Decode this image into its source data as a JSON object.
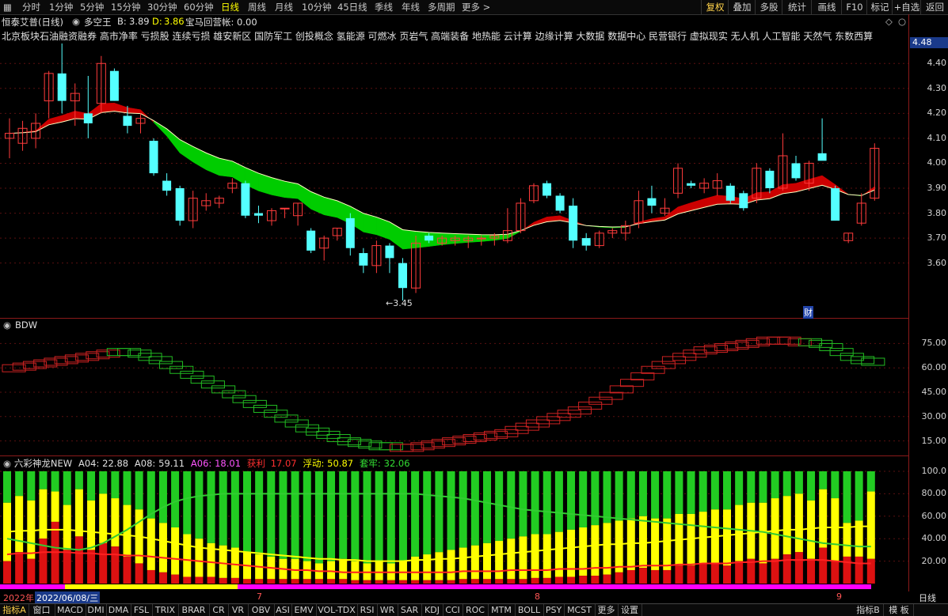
{
  "periods": [
    "分时",
    "1分钟",
    "5分钟",
    "15分钟",
    "30分钟",
    "60分钟",
    "日线",
    "周线",
    "月线",
    "10分钟",
    "45日线",
    "季线",
    "年线",
    "多周期",
    "更多 >"
  ],
  "active_period": "日线",
  "right_tools": [
    "复权",
    "叠加",
    "多股",
    "统计",
    "画线",
    "F10",
    "标记",
    "+自选",
    "返回"
  ],
  "title": {
    "stock": "恒泰艾普(日线)",
    "indicator": "多空王",
    "b_label": "B:",
    "b_value": "3.89",
    "d_label": "D:",
    "d_value": "3.86",
    "extra": "宝马回营帐: 0.00"
  },
  "sectors": "北京板块石油融资融券 高市净率 亏损股 连续亏损 雄安新区 国防军工 创投概念 氢能源 可燃冰 页岩气 高端装备 地热能 云计算 边缘计算 大数据 数据中心 民营银行 虚拟现实 无人机 人工智能 天然气 东数西算",
  "price_axis": {
    "current": "4.48",
    "ticks": [
      "4.40",
      "4.30",
      "4.20",
      "4.10",
      "4.00",
      "3.90",
      "3.80",
      "3.70",
      "3.60"
    ],
    "low_label": "3.45",
    "cai_label": "财"
  },
  "bdw": {
    "title": "BDW",
    "ticks": [
      "75.00",
      "60.00",
      "45.00",
      "30.00",
      "15.00"
    ]
  },
  "liucai": {
    "name": "六彩神龙NEW",
    "a04_label": "A04:",
    "a04": "22.88",
    "a08_label": "A08:",
    "a08": "59.11",
    "a06_label": "A06:",
    "a06": "18.01",
    "profit_label": "获利",
    "profit": "17.07",
    "float_label": "浮动:",
    "float": "50.87",
    "trap_label": "套牢:",
    "trap": "32.06",
    "ticks": [
      "100.0",
      "80.00",
      "60.00",
      "40.00",
      "20.00"
    ]
  },
  "date_axis": {
    "year": "2022年",
    "cursor_date": "2022/06/08/三",
    "months": [
      "7",
      "8",
      "9"
    ],
    "right_label": "日线"
  },
  "bottom_tabs": [
    "指标A",
    "窗口",
    "MACD",
    "DMI",
    "DMA",
    "FSL",
    "TRIX",
    "BRAR",
    "CR",
    "VR",
    "OBV",
    "ASI",
    "EMV",
    "VOL-TDX",
    "RSI",
    "WR",
    "SAR",
    "KDJ",
    "CCI",
    "ROC",
    "MTM",
    "BOLL",
    "PSY",
    "MCST",
    "更多",
    "设置"
  ],
  "bottom_right": [
    "指标B",
    "模 板"
  ],
  "colors": {
    "up": "#ff3b3b",
    "down": "#54ffff",
    "ma_red": "#cc0000",
    "ma_green": "#00cc00",
    "yellow": "#ffff00",
    "magenta": "#ff00ff"
  },
  "chart_data": [
    {
      "type": "candlestick",
      "title": "恒泰艾普(日线)",
      "ylim": [
        3.45,
        4.48
      ],
      "candles": [
        {
          "o": 4.1,
          "h": 4.18,
          "l": 4.02,
          "c": 4.12
        },
        {
          "o": 4.08,
          "h": 4.17,
          "l": 4.05,
          "c": 4.14
        },
        {
          "o": 4.1,
          "h": 4.2,
          "l": 4.06,
          "c": 4.16
        },
        {
          "o": 4.25,
          "h": 4.37,
          "l": 4.18,
          "c": 4.36
        },
        {
          "o": 4.36,
          "h": 4.48,
          "l": 4.2,
          "c": 4.25
        },
        {
          "o": 4.25,
          "h": 4.32,
          "l": 4.15,
          "c": 4.28
        },
        {
          "o": 4.2,
          "h": 4.35,
          "l": 4.1,
          "c": 4.16
        },
        {
          "o": 4.24,
          "h": 4.43,
          "l": 4.2,
          "c": 4.4
        },
        {
          "o": 4.37,
          "h": 4.38,
          "l": 4.25,
          "c": 4.25
        },
        {
          "o": 4.19,
          "h": 4.23,
          "l": 4.12,
          "c": 4.15
        },
        {
          "o": 4.16,
          "h": 4.2,
          "l": 4.12,
          "c": 4.18
        },
        {
          "o": 4.09,
          "h": 4.1,
          "l": 3.95,
          "c": 3.96
        },
        {
          "o": 3.93,
          "h": 3.96,
          "l": 3.87,
          "c": 3.89
        },
        {
          "o": 3.9,
          "h": 3.91,
          "l": 3.75,
          "c": 3.77
        },
        {
          "o": 3.77,
          "h": 3.89,
          "l": 3.74,
          "c": 3.86
        },
        {
          "o": 3.83,
          "h": 3.88,
          "l": 3.81,
          "c": 3.85
        },
        {
          "o": 3.84,
          "h": 3.87,
          "l": 3.82,
          "c": 3.86
        },
        {
          "o": 3.9,
          "h": 3.94,
          "l": 3.88,
          "c": 3.92
        },
        {
          "o": 3.92,
          "h": 3.93,
          "l": 3.78,
          "c": 3.79
        },
        {
          "o": 3.8,
          "h": 3.83,
          "l": 3.76,
          "c": 3.79
        },
        {
          "o": 3.77,
          "h": 3.82,
          "l": 3.75,
          "c": 3.81
        },
        {
          "o": 3.82,
          "h": 3.82,
          "l": 3.78,
          "c": 3.82
        },
        {
          "o": 3.79,
          "h": 3.84,
          "l": 3.75,
          "c": 3.84
        },
        {
          "o": 3.73,
          "h": 3.74,
          "l": 3.64,
          "c": 3.65
        },
        {
          "o": 3.66,
          "h": 3.71,
          "l": 3.61,
          "c": 3.7
        },
        {
          "o": 3.71,
          "h": 3.74,
          "l": 3.69,
          "c": 3.74
        },
        {
          "o": 3.78,
          "h": 3.8,
          "l": 3.63,
          "c": 3.66
        },
        {
          "o": 3.64,
          "h": 3.66,
          "l": 3.56,
          "c": 3.59
        },
        {
          "o": 3.59,
          "h": 3.69,
          "l": 3.56,
          "c": 3.67
        },
        {
          "o": 3.67,
          "h": 3.68,
          "l": 3.56,
          "c": 3.62
        },
        {
          "o": 3.6,
          "h": 3.62,
          "l": 3.45,
          "c": 3.5
        },
        {
          "o": 3.5,
          "h": 3.71,
          "l": 3.48,
          "c": 3.68
        },
        {
          "o": 3.71,
          "h": 3.72,
          "l": 3.68,
          "c": 3.69
        },
        {
          "o": 3.68,
          "h": 3.71,
          "l": 3.67,
          "c": 3.7
        },
        {
          "o": 3.69,
          "h": 3.71,
          "l": 3.67,
          "c": 3.7
        },
        {
          "o": 3.69,
          "h": 3.71,
          "l": 3.66,
          "c": 3.7
        },
        {
          "o": 3.7,
          "h": 3.71,
          "l": 3.67,
          "c": 3.7
        },
        {
          "o": 3.7,
          "h": 3.72,
          "l": 3.67,
          "c": 3.71
        },
        {
          "o": 3.69,
          "h": 3.82,
          "l": 3.68,
          "c": 3.73
        },
        {
          "o": 3.73,
          "h": 3.86,
          "l": 3.72,
          "c": 3.84
        },
        {
          "o": 3.85,
          "h": 3.92,
          "l": 3.84,
          "c": 3.91
        },
        {
          "o": 3.92,
          "h": 3.93,
          "l": 3.86,
          "c": 3.87
        },
        {
          "o": 3.87,
          "h": 3.88,
          "l": 3.8,
          "c": 3.81
        },
        {
          "o": 3.83,
          "h": 3.86,
          "l": 3.66,
          "c": 3.69
        },
        {
          "o": 3.7,
          "h": 3.72,
          "l": 3.65,
          "c": 3.67
        },
        {
          "o": 3.67,
          "h": 3.73,
          "l": 3.66,
          "c": 3.72
        },
        {
          "o": 3.72,
          "h": 3.74,
          "l": 3.7,
          "c": 3.73
        },
        {
          "o": 3.72,
          "h": 3.77,
          "l": 3.69,
          "c": 3.75
        },
        {
          "o": 3.76,
          "h": 3.89,
          "l": 3.74,
          "c": 3.85
        },
        {
          "o": 3.86,
          "h": 3.91,
          "l": 3.8,
          "c": 3.83
        },
        {
          "o": 3.8,
          "h": 3.86,
          "l": 3.79,
          "c": 3.82
        },
        {
          "o": 3.88,
          "h": 4.0,
          "l": 3.86,
          "c": 3.98
        },
        {
          "o": 3.92,
          "h": 3.93,
          "l": 3.9,
          "c": 3.91
        },
        {
          "o": 3.9,
          "h": 3.94,
          "l": 3.88,
          "c": 3.92
        },
        {
          "o": 3.9,
          "h": 3.96,
          "l": 3.87,
          "c": 3.93
        },
        {
          "o": 3.91,
          "h": 3.92,
          "l": 3.84,
          "c": 3.85
        },
        {
          "o": 3.88,
          "h": 3.89,
          "l": 3.81,
          "c": 3.82
        },
        {
          "o": 3.86,
          "h": 4.0,
          "l": 3.84,
          "c": 3.98
        },
        {
          "o": 3.97,
          "h": 3.98,
          "l": 3.88,
          "c": 3.9
        },
        {
          "o": 3.9,
          "h": 4.12,
          "l": 3.89,
          "c": 4.03
        },
        {
          "o": 4.0,
          "h": 4.03,
          "l": 3.93,
          "c": 3.94
        },
        {
          "o": 3.92,
          "h": 4.01,
          "l": 3.89,
          "c": 4.0
        },
        {
          "o": 4.04,
          "h": 4.18,
          "l": 4.03,
          "c": 4.01
        },
        {
          "o": 3.9,
          "h": 3.91,
          "l": 3.77,
          "c": 3.77
        },
        {
          "o": 3.69,
          "h": 3.72,
          "l": 3.68,
          "c": 3.72
        },
        {
          "o": 3.76,
          "h": 3.88,
          "l": 3.75,
          "c": 3.84
        },
        {
          "o": 3.86,
          "h": 4.08,
          "l": 3.85,
          "c": 4.06
        }
      ]
    },
    {
      "type": "line",
      "title": "BDW",
      "ylim": [
        8,
        82
      ],
      "series": [
        {
          "values": [
            60,
            61,
            62,
            63,
            64,
            65,
            66,
            67,
            68,
            69,
            70,
            70,
            69,
            67,
            65,
            62,
            59,
            56,
            53,
            50,
            47,
            44,
            41,
            38,
            35,
            32,
            29,
            26,
            23,
            21,
            19,
            17,
            15,
            14,
            13,
            12,
            12,
            11,
            11,
            12,
            13,
            14,
            15,
            16,
            17,
            18,
            19,
            20,
            22,
            24,
            26,
            28,
            30,
            32,
            34,
            37,
            40,
            43,
            47,
            51,
            55,
            59,
            62,
            65,
            67,
            69,
            71,
            72,
            73,
            74,
            75,
            76,
            77,
            77,
            77,
            76,
            76,
            75,
            73,
            70,
            67,
            65,
            64
          ]
        }
      ]
    },
    {
      "type": "bar",
      "title": "六彩神龙NEW",
      "ylim": [
        0,
        100
      ],
      "stacks": {
        "red": [
          20,
          28,
          22,
          40,
          55,
          30,
          42,
          30,
          36,
          33,
          24,
          18,
          12,
          10,
          8,
          6,
          6,
          6,
          5,
          5,
          4,
          4,
          4,
          4,
          4,
          4,
          4,
          4,
          4,
          3,
          3,
          3,
          3,
          3,
          3,
          3,
          3,
          3,
          4,
          4,
          4,
          4,
          4,
          4,
          5,
          5,
          6,
          6,
          7,
          7,
          8,
          10,
          12,
          14,
          12,
          12,
          16,
          16,
          18,
          18,
          16,
          20,
          22,
          18,
          22,
          26,
          28,
          22,
          32,
          20,
          24,
          24,
          22
        ],
        "yellow": [
          72,
          78,
          74,
          84,
          82,
          70,
          84,
          74,
          80,
          76,
          70,
          66,
          58,
          54,
          50,
          44,
          40,
          36,
          34,
          32,
          28,
          26,
          24,
          22,
          22,
          20,
          18,
          20,
          22,
          20,
          18,
          20,
          18,
          20,
          24,
          26,
          28,
          30,
          32,
          34,
          36,
          38,
          40,
          42,
          44,
          44,
          46,
          48,
          50,
          52,
          54,
          56,
          58,
          60,
          58,
          58,
          62,
          62,
          64,
          66,
          66,
          70,
          72,
          72,
          76,
          78,
          80,
          74,
          84,
          76,
          54,
          56,
          82
        ],
        "green": [
          100,
          100,
          100,
          100,
          100,
          100,
          100,
          100,
          100,
          100,
          100,
          100,
          100,
          100,
          100,
          100,
          100,
          100,
          100,
          100,
          100,
          100,
          100,
          100,
          100,
          100,
          100,
          100,
          100,
          100,
          100,
          100,
          100,
          100,
          100,
          100,
          100,
          100,
          100,
          100,
          100,
          100,
          100,
          100,
          100,
          100,
          100,
          100,
          100,
          100,
          100,
          100,
          100,
          100,
          100,
          100,
          100,
          100,
          100,
          100,
          100,
          100,
          100,
          100,
          100,
          100,
          100,
          100,
          100,
          100,
          100,
          100,
          100
        ]
      },
      "series": [
        {
          "color": "#ffff00",
          "values": [
            46,
            47,
            47,
            48,
            48,
            48,
            47,
            46,
            45,
            44,
            43,
            42,
            40,
            38,
            36,
            34,
            32,
            31,
            30,
            29,
            28,
            27,
            26,
            25,
            24,
            23,
            22,
            22,
            21,
            21,
            20,
            20,
            20,
            20,
            21,
            21,
            22,
            22,
            23,
            24,
            25,
            26,
            27,
            28,
            29,
            30,
            31,
            32,
            33,
            34,
            35,
            35,
            36,
            36,
            37,
            38,
            39,
            40,
            41,
            42,
            43,
            44,
            45,
            46,
            47,
            48,
            48,
            49,
            50,
            50,
            50,
            51,
            51
          ]
        },
        {
          "color": "#33cc33",
          "values": [
            40,
            38,
            36,
            34,
            32,
            31,
            30,
            32,
            36,
            42,
            48,
            55,
            62,
            68,
            73,
            76,
            78,
            79,
            80,
            80,
            80,
            80,
            80,
            80,
            80,
            80,
            80,
            80,
            80,
            80,
            80,
            80,
            80,
            80,
            80,
            79,
            78,
            77,
            76,
            74,
            72,
            70,
            68,
            66,
            65,
            64,
            63,
            62,
            61,
            60,
            59,
            58,
            57,
            56,
            55,
            54,
            53,
            52,
            51,
            50,
            49,
            48,
            47,
            46,
            44,
            42,
            40,
            38,
            36,
            35,
            34,
            33,
            33
          ]
        },
        {
          "color": "#ff2020",
          "values": [
            26,
            27,
            27,
            28,
            28,
            28,
            27,
            27,
            26,
            26,
            25,
            25,
            24,
            23,
            22,
            21,
            20,
            19,
            18,
            17,
            16,
            15,
            14,
            13,
            12,
            12,
            11,
            11,
            10,
            10,
            10,
            10,
            10,
            10,
            10,
            10,
            10,
            10,
            11,
            11,
            11,
            11,
            12,
            12,
            12,
            12,
            13,
            13,
            13,
            14,
            14,
            15,
            15,
            16,
            16,
            16,
            17,
            17,
            18,
            18,
            18,
            19,
            19,
            20,
            20,
            21,
            21,
            21,
            21,
            20,
            19,
            18,
            18
          ]
        }
      ]
    }
  ]
}
